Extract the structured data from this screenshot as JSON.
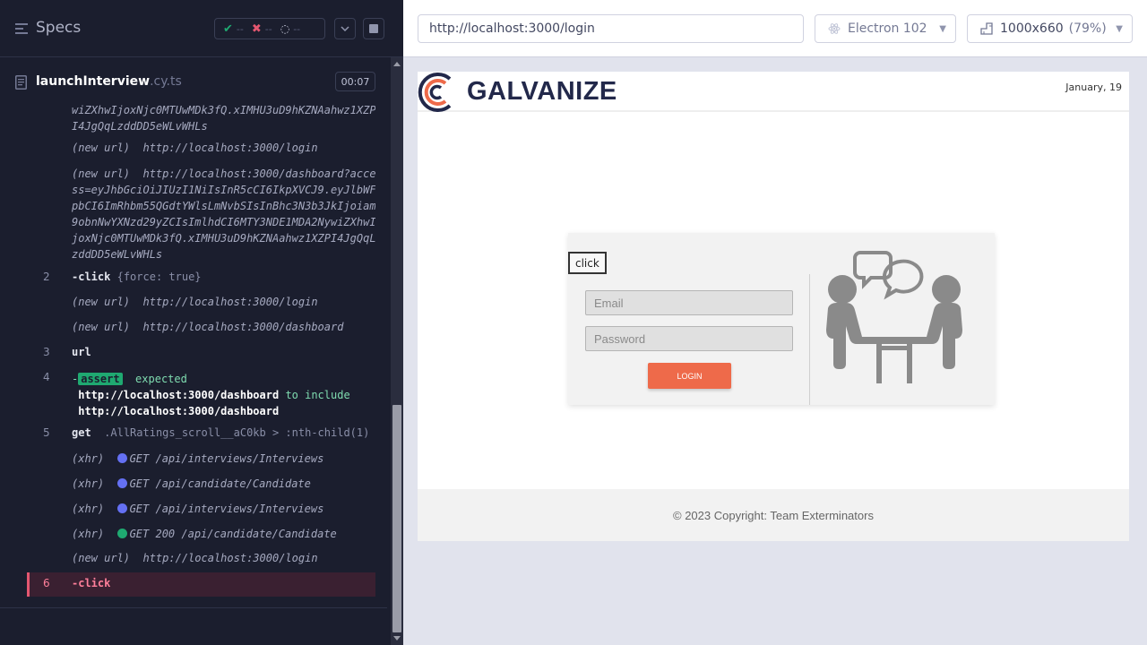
{
  "reporter": {
    "title": "Specs",
    "stats": {
      "passed": "--",
      "failed": "--",
      "pending": "--"
    },
    "spec": {
      "name": "launchInterview",
      "ext": ".cy.ts",
      "duration": "00:07"
    },
    "log": {
      "token_tail": "wiZXhwIjoxNjc0MTUwMDk3fQ.xIMHU3uD9hKZNAahwz1XZPI4JgQqLzddDD5eWLvWHLs",
      "new_url_1": {
        "prefix": "(new url)",
        "url": "http://localhost:3000/login"
      },
      "new_url_2": {
        "prefix": "(new url)",
        "url": "http://localhost:3000/dashboard?access=eyJhbGciOiJIUzI1NiIsInR5cCI6IkpXVCJ9.eyJlbWFpbCI6ImRhbm55QGdtYWlsLmNvbSIsInBhc3N3b3JkIjoiam9obnNwYXNzd29yZCIsImlhdCI6MTY3NDE1MDA2NywiZXhwIjoxNjc0MTUwMDk3fQ.xIMHU3uD9hKZNAahwz1XZPI4JgQqLzddDD5eWLvWHLs"
      },
      "step2": {
        "num": "2",
        "cmd": "-click",
        "args": "{force: true}"
      },
      "new_url_3": {
        "prefix": "(new url)",
        "url": "http://localhost:3000/login"
      },
      "new_url_4": {
        "prefix": "(new url)",
        "url": "http://localhost:3000/dashboard"
      },
      "step3": {
        "num": "3",
        "cmd": "url"
      },
      "step4": {
        "num": "4",
        "dash": "-",
        "badge": "assert",
        "expected": "expected",
        "actual": "http://localhost:3000/dashboard",
        "to_include": "to include",
        "target": "http://localhost:3000/dashboard"
      },
      "step5": {
        "num": "5",
        "cmd": "get",
        "selector": ".AllRatings_scroll__aC0kb > :nth-child(1)"
      },
      "xhr1": {
        "prefix": "(xhr)",
        "text": "GET /api/interviews/Interviews",
        "status": "pending"
      },
      "xhr2": {
        "prefix": "(xhr)",
        "text": "GET /api/candidate/Candidate",
        "status": "pending"
      },
      "xhr3": {
        "prefix": "(xhr)",
        "text": "GET /api/interviews/Interviews",
        "status": "pending"
      },
      "xhr4": {
        "prefix": "(xhr)",
        "text": "GET 200 /api/candidate/Candidate",
        "status": "success"
      },
      "new_url_5": {
        "prefix": "(new url)",
        "url": "http://localhost:3000/login"
      },
      "step6": {
        "num": "6",
        "cmd": "-click"
      }
    }
  },
  "aut": {
    "url": "http://localhost:3000/login",
    "browser": "Electron 102",
    "viewport": "1000x660",
    "zoom": "(79%)",
    "app": {
      "logo": "GALVANIZE",
      "date": "January, 19",
      "click_tag": "click",
      "email_placeholder": "Email",
      "password_placeholder": "Password",
      "login_label": "LOGIN",
      "footer": "© 2023 Copyright: Team Exterminators"
    }
  },
  "colors": {
    "reporter_bg": "#1b1e2e",
    "pass": "#1fa971",
    "fail": "#e45770",
    "login_button": "#ee6a4a",
    "brand_navy": "#22284a"
  }
}
